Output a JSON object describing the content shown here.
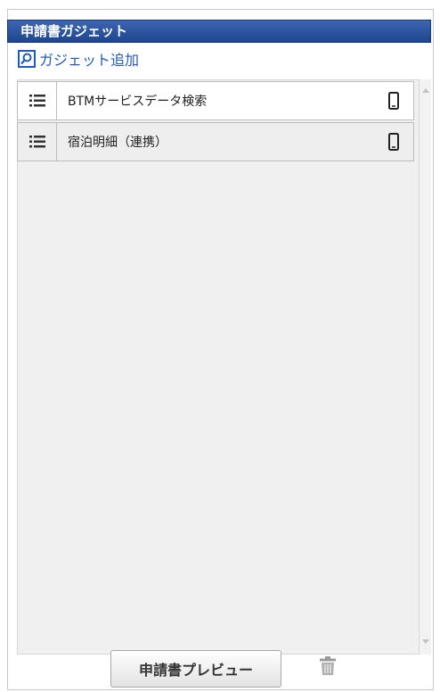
{
  "panel": {
    "title": "申請書ガジェット"
  },
  "add_gadget": {
    "label": "ガジェット追加",
    "icon": "search-icon"
  },
  "gadgets": [
    {
      "label": "BTMサービスデータ検索",
      "handle_icon": "list-icon",
      "device_icon": "smartphone-icon"
    },
    {
      "label": "宿泊明細（連携）",
      "handle_icon": "list-icon",
      "device_icon": "smartphone-icon"
    }
  ],
  "footer": {
    "preview_label": "申請書プレビュー",
    "delete_icon": "trash-icon"
  },
  "colors": {
    "header_bg": "#2a4f9e",
    "link": "#2159c4",
    "list_bg": "#f0f0f0"
  }
}
